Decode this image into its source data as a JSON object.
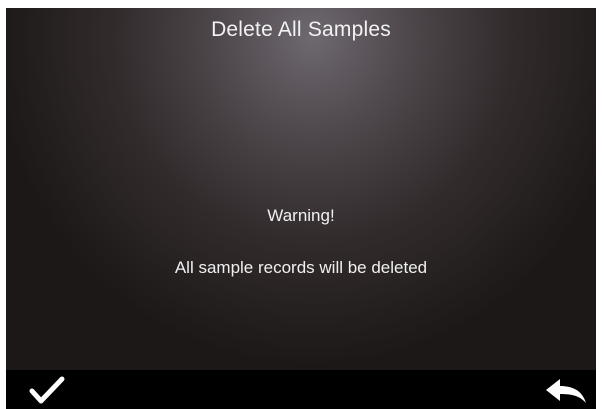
{
  "screen": {
    "title": "Delete All Samples",
    "warning": "Warning!",
    "message": "All sample records will be deleted"
  },
  "bottom_bar": {
    "confirm_icon": "check-icon",
    "back_icon": "back-arrow-icon"
  },
  "colors": {
    "background_top": "#6e6870",
    "background_edge": "#1c1817",
    "bar": "#000000",
    "text": "#f0f0f0"
  }
}
